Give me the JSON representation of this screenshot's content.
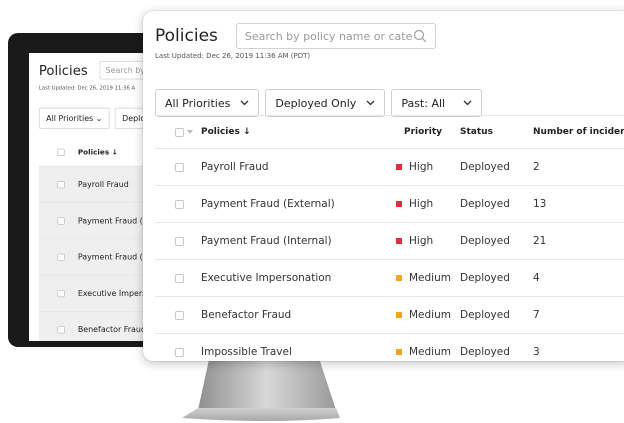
{
  "app": {
    "title": "Policies",
    "search_placeholder": "Search by policy name or category",
    "last_updated": "Last Updated: Dec 26, 2019 11:36 AM (PDT)"
  },
  "filters": [
    {
      "label": "All Priorities"
    },
    {
      "label": "Deployed Only"
    },
    {
      "label": "Past: All"
    }
  ],
  "table": {
    "columns": {
      "policies": "Policies ↓",
      "priority": "Priority",
      "status": "Status",
      "incidents": "Number of incidents"
    },
    "rows": [
      {
        "name": "Payroll Fraud",
        "priority": "High",
        "status": "Deployed",
        "incidents": "2"
      },
      {
        "name": "Payment Fraud (External)",
        "priority": "High",
        "status": "Deployed",
        "incidents": "13"
      },
      {
        "name": "Payment Fraud (Internal)",
        "priority": "High",
        "status": "Deployed",
        "incidents": "21"
      },
      {
        "name": "Executive Impersonation",
        "priority": "Medium",
        "status": "Deployed",
        "incidents": "4"
      },
      {
        "name": "Benefactor Fraud",
        "priority": "Medium",
        "status": "Deployed",
        "incidents": "7"
      },
      {
        "name": "Impossible Travel",
        "priority": "Medium",
        "status": "Deployed",
        "incidents": "3"
      }
    ]
  },
  "tablet": {
    "search_placeholder": "Search by po",
    "last_updated": "Last Updated: Dec 26, 2019 11:36 A",
    "filters": [
      "All Priorities",
      "Deplo"
    ],
    "rows": [
      "Payroll Fraud",
      "Payment Fraud (Ex",
      "Payment Fraud (In",
      "Executive Imperso",
      "Benefactor Fraud"
    ]
  },
  "colors": {
    "high": "#e0303c",
    "medium": "#f2a51e"
  }
}
